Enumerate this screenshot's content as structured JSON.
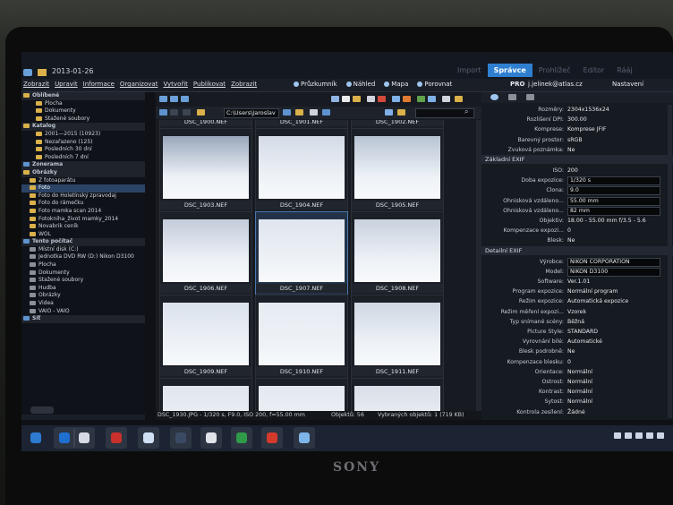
{
  "window": {
    "title": "2013-01-26"
  },
  "modes": [
    "Import",
    "Správce",
    "Prohlížeč",
    "Editor",
    "Rááj"
  ],
  "active_mode": "Správce",
  "menu": [
    "Zobrazit",
    "Upravit",
    "Informace",
    "Organizovat",
    "Vytvořit",
    "Publikovat",
    "Zobrazit"
  ],
  "toolbar_right": {
    "pruzkumnik": "Průzkumník",
    "nahled": "Náhled",
    "mapa": "Mapa",
    "porovnat": "Porovnat"
  },
  "account": {
    "pro": "PRO",
    "user": "j.jelinek@atlas.cz",
    "settings": "Nastavení"
  },
  "tree": [
    {
      "label": "Oblíbené",
      "head": true,
      "icon": "star-icon"
    },
    {
      "label": "Plocha",
      "indent": 2
    },
    {
      "label": "Dokumenty",
      "indent": 2
    },
    {
      "label": "Stažené soubory",
      "indent": 2
    },
    {
      "label": "Katalog",
      "head": true,
      "icon": "catalog-icon"
    },
    {
      "label": "2001—2015 (10923)",
      "indent": 2
    },
    {
      "label": "Nezařazeno (125)",
      "indent": 2
    },
    {
      "label": "Posledních 30 dní",
      "indent": 2
    },
    {
      "label": "Posledních 7 dní",
      "indent": 2
    },
    {
      "label": "Zonerama",
      "head": true,
      "icon": "zonerama-icon"
    },
    {
      "label": "Obrázky",
      "head": true,
      "icon": "pictures-icon"
    },
    {
      "label": "Z fotoaparátu",
      "indent": 1
    },
    {
      "label": "Foto",
      "indent": 1,
      "selected": true
    },
    {
      "label": "Foto do Holetínský zpravodaj",
      "indent": 1
    },
    {
      "label": "Foto do rámečku",
      "indent": 1
    },
    {
      "label": "Foto mamka scan 2014",
      "indent": 1
    },
    {
      "label": "Fotokniha_život mamky_2014",
      "indent": 1
    },
    {
      "label": "Novabrik ceník",
      "indent": 1
    },
    {
      "label": "WOL",
      "indent": 1
    },
    {
      "label": "Tento počítač",
      "head": true,
      "icon": "computer-icon"
    },
    {
      "label": "Místní disk (C:)",
      "indent": 1
    },
    {
      "label": "Jednotka DVD RW (D:) Nikon D3100",
      "indent": 1
    },
    {
      "label": "Plocha",
      "indent": 1
    },
    {
      "label": "Dokumenty",
      "indent": 1
    },
    {
      "label": "Stažené soubory",
      "indent": 1
    },
    {
      "label": "Hudba",
      "indent": 1
    },
    {
      "label": "Obrázky",
      "indent": 1
    },
    {
      "label": "Videa",
      "indent": 1
    },
    {
      "label": "VAIO - VAIO",
      "indent": 1
    },
    {
      "label": "Síť",
      "head": true,
      "icon": "network-icon"
    }
  ],
  "path": "C:\\Users\\Jaroslav",
  "thumbnails": [
    {
      "name": "DSC_1900.NEF"
    },
    {
      "name": "DSC_1901.NEF"
    },
    {
      "name": "DSC_1902.NEF"
    },
    {
      "name": "DSC_1903.NEF"
    },
    {
      "name": "DSC_1904.NEF"
    },
    {
      "name": "DSC_1905.NEF"
    },
    {
      "name": "DSC_1906.NEF"
    },
    {
      "name": "DSC_1907.NEF",
      "selected": true
    },
    {
      "name": "DSC_1908.NEF"
    },
    {
      "name": "DSC_1909.NEF"
    },
    {
      "name": "DSC_1910.NEF"
    },
    {
      "name": "DSC_1911.NEF"
    },
    {
      "name": ""
    },
    {
      "name": ""
    },
    {
      "name": ""
    }
  ],
  "status": {
    "info": "DSC_1930.JPG - 1/320 s, F9.0, ISO 200, f=55.00 mm",
    "objects": "Objektů: 56",
    "selected": "Vybraných objektů: 1 (719 KB)"
  },
  "props_top": [
    {
      "k": "Rozměry:",
      "v": "2304x1536x24"
    },
    {
      "k": "Rozlišení DPI:",
      "v": "300.00"
    },
    {
      "k": "Komprese:",
      "v": "Komprese JFIF"
    },
    {
      "k": "Barevný prostor:",
      "v": "sRGB"
    },
    {
      "k": "Zvuková poznámka:",
      "v": "Ne"
    }
  ],
  "sect_exif": "Základní EXIF",
  "props_exif": [
    {
      "k": "ISO:",
      "v": "200"
    },
    {
      "k": "Doba expozice:",
      "v": "1/320 s",
      "box": true
    },
    {
      "k": "Clona:",
      "v": "9.0",
      "box": true
    },
    {
      "k": "Ohnisková vzdáleno...",
      "v": "55.00 mm",
      "box": true
    },
    {
      "k": "Ohnisková vzdáleno...",
      "v": "82 mm",
      "box": true
    },
    {
      "k": "Objektiv:",
      "v": "18.00 - 55.00 mm f/3.5 - 5.6"
    },
    {
      "k": "Kompenzace expozi...",
      "v": "0"
    },
    {
      "k": "Blesk:",
      "v": "Ne"
    }
  ],
  "sect_detail": "Detailní EXIF",
  "props_detail": [
    {
      "k": "Výrobce:",
      "v": "NIKON CORPORATION",
      "box": true
    },
    {
      "k": "Model:",
      "v": "NIKON D3100",
      "box": true
    },
    {
      "k": "Software:",
      "v": "Ver.1.01"
    },
    {
      "k": "Program expozice:",
      "v": "Normální program"
    },
    {
      "k": "Režim expozice:",
      "v": "Automatická expozice"
    },
    {
      "k": "Režim měření expozi...",
      "v": "Vzorek"
    },
    {
      "k": "Typ snímané scény:",
      "v": "Běžná"
    },
    {
      "k": "Picture Style:",
      "v": "STANDARD"
    },
    {
      "k": "Vyrovnání bílé:",
      "v": "Automatické"
    },
    {
      "k": "Blesk podrobně:",
      "v": "Ne"
    },
    {
      "k": "Kompenzace blesku:",
      "v": "0"
    },
    {
      "k": "Orientace:",
      "v": "Normální"
    },
    {
      "k": "Ostrost:",
      "v": "Normální"
    },
    {
      "k": "Kontrast:",
      "v": "Normální"
    },
    {
      "k": "Sytost:",
      "v": "Normální"
    },
    {
      "k": "Kontrola zesílení:",
      "v": "Žádné"
    }
  ],
  "brand": "SONY",
  "taskbar_apps": [
    "windows-start-icon",
    "ie-icon",
    "explorer-icon",
    "zoner-icon",
    "app-icon",
    "network-app-icon",
    "chrome-icon",
    "excel-icon",
    "pdf-icon",
    "photo-app-icon"
  ]
}
